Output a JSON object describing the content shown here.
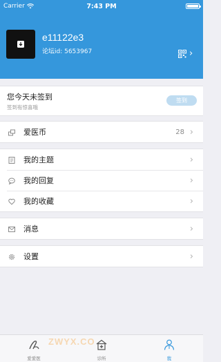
{
  "status": {
    "carrier": "Carrier",
    "time": "7:43 PM"
  },
  "profile": {
    "username": "e11122e3",
    "forum_id": "论坛id:  5653967"
  },
  "checkin": {
    "title": "您今天未签到",
    "subtitle": "签到有惊喜哦",
    "button": "签到"
  },
  "coins": {
    "label": "爱医币",
    "count": "28"
  },
  "activity": [
    {
      "label": "我的主题",
      "icon": "document-icon"
    },
    {
      "label": "我的回复",
      "icon": "comment-icon"
    },
    {
      "label": "我的收藏",
      "icon": "heart-icon"
    }
  ],
  "messages": {
    "label": "消息",
    "icon": "envelope-icon"
  },
  "settings": {
    "label": "设置",
    "icon": "gear-icon"
  },
  "tabs": [
    {
      "label": "爱爱医",
      "icon": "aiaiyi-logo-icon",
      "active": false
    },
    {
      "label": "诊所",
      "icon": "clinic-icon",
      "active": false
    },
    {
      "label": "我",
      "icon": "doctor-icon",
      "active": true
    }
  ],
  "watermark": "ZWYX.CO",
  "colors": {
    "accent": "#3597dc",
    "background": "#efeff4"
  }
}
